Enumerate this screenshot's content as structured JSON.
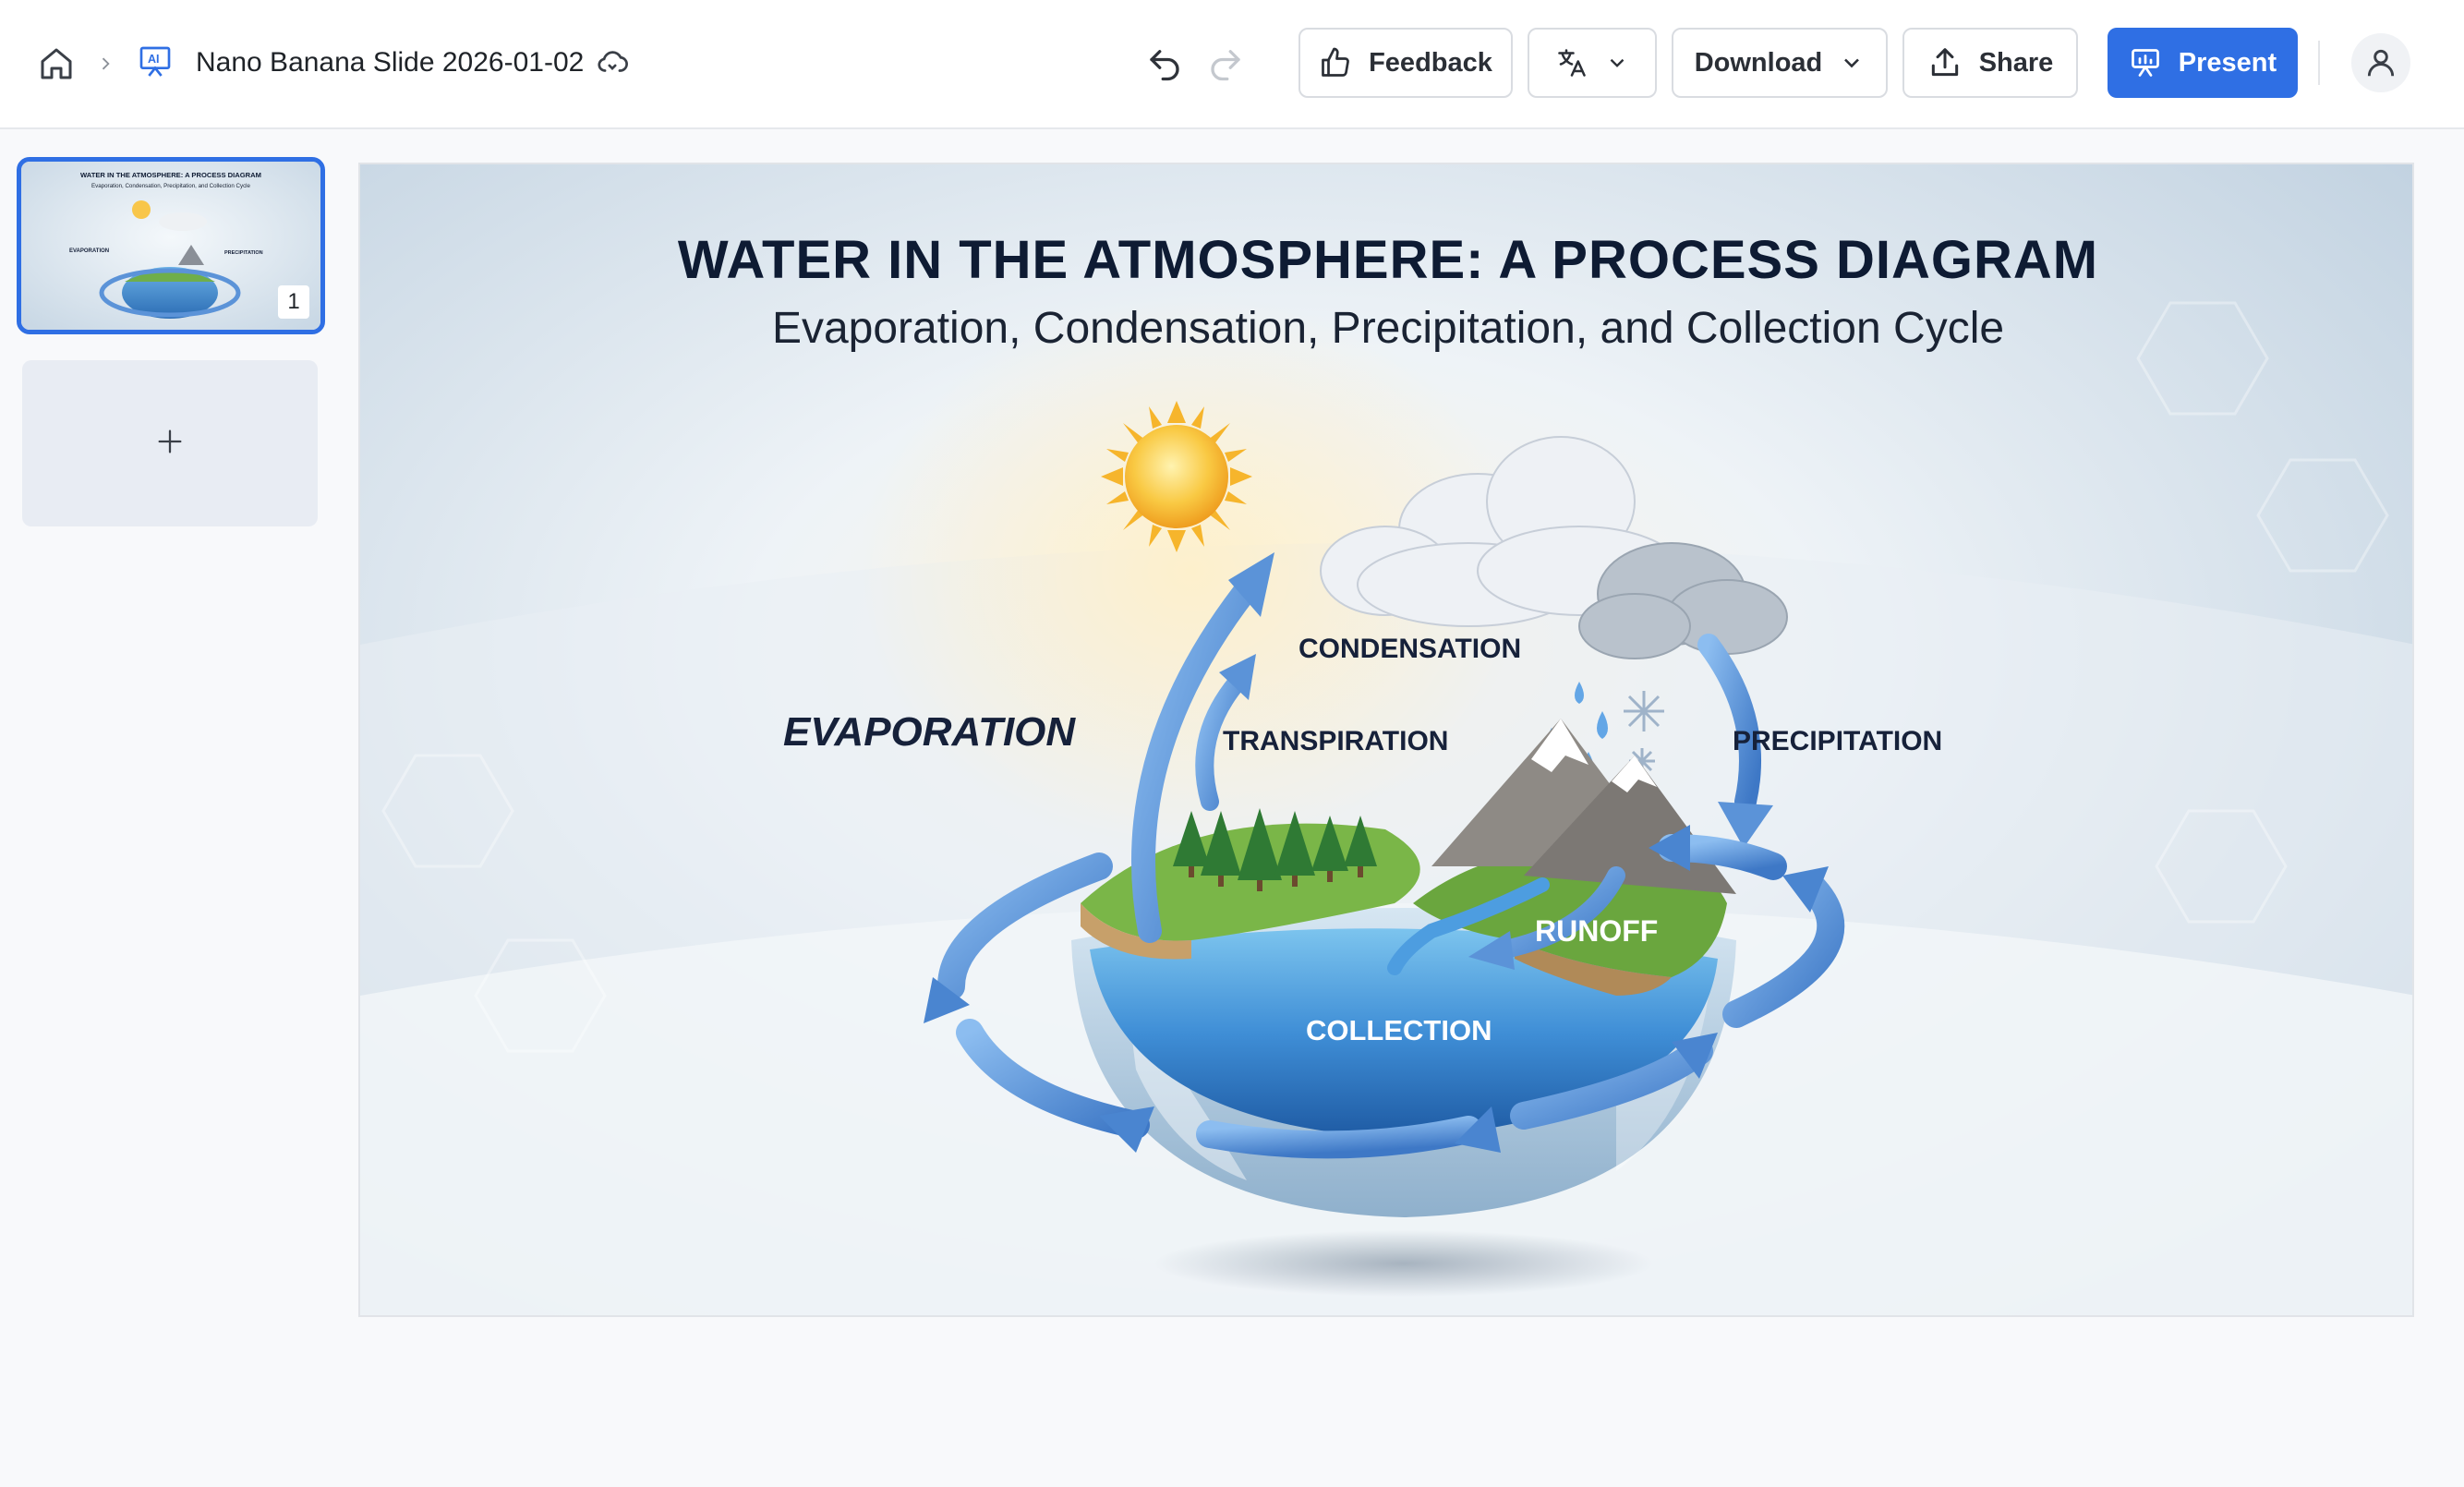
{
  "header": {
    "document_title": "Nano Banana Slide 2026-01-02",
    "feedback_label": "Feedback",
    "download_label": "Download",
    "share_label": "Share",
    "present_label": "Present",
    "icons": {
      "home": "home-icon",
      "breadcrumb_separator": "chevron-right-icon",
      "document": "ai-presentation-icon",
      "cloud_sync": "cloud-sync-icon",
      "undo": "undo-icon",
      "redo": "redo-icon",
      "feedback": "thumbs-up-icon",
      "translate": "translate-icon",
      "download_dropdown": "chevron-down-icon",
      "share": "upload-icon",
      "present": "presentation-icon",
      "account": "user-icon"
    }
  },
  "sidebar": {
    "slides": [
      {
        "number": "1",
        "selected": true,
        "mini_title": "WATER IN THE ATMOSPHERE: A PROCESS DIAGRAM",
        "mini_subtitle": "Evaporation, Condensation, Precipitation, and Collection Cycle"
      }
    ],
    "add_slide_symbol": "+"
  },
  "slide": {
    "title": "WATER IN THE ATMOSPHERE: A PROCESS DIAGRAM",
    "subtitle": "Evaporation, Condensation, Precipitation, and Collection Cycle",
    "labels": {
      "evaporation": "EVAPORATION",
      "condensation": "CONDENSATION",
      "transpiration": "TRANSPIRATION",
      "precipitation": "PRECIPITATION",
      "runoff": "RUNOFF",
      "collection": "COLLECTION"
    }
  },
  "colors": {
    "accent": "#2f6fe4",
    "title_text": "#0e1b33",
    "cycle_arrow": "#5b93d8",
    "water": "#3f8ed6"
  }
}
